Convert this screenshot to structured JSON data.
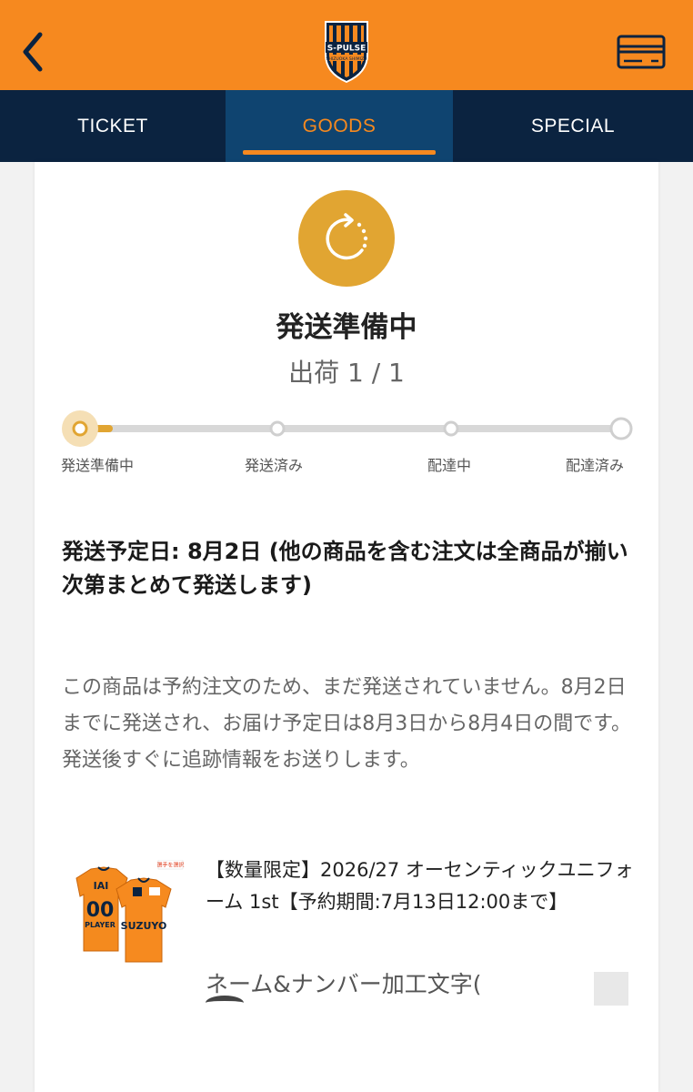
{
  "header": {
    "back_icon": "chevron-left-icon",
    "logo_text": "S-PULSE",
    "logo_subtext": "SHIZUOKA SHIMIZU",
    "card_icon": "credit-card-icon",
    "colors": {
      "orange": "#f6891f",
      "navy": "#0b2340",
      "active_tab_bg": "#0f4470"
    }
  },
  "tabs": [
    {
      "label": "TICKET",
      "active": false
    },
    {
      "label": "GOODS",
      "active": true
    },
    {
      "label": "SPECIAL",
      "active": false
    }
  ],
  "status": {
    "icon": "loading-circle-icon",
    "title": "発送準備中",
    "shipment": "出荷 1 / 1",
    "accent_color": "#e1a532",
    "steps": [
      "発送準備中",
      "発送済み",
      "配達中",
      "配達済み"
    ],
    "current_step": 1
  },
  "ship_date_text": "発送予定日: 8月2日 (他の商品を含む注文は全商品が揃い次第まとめて発送します)",
  "notice_text": "この商品は予約注文のため、まだ発送されていません。8月2日までに発送され、お届け予定日は8月3日から8月4日の間です。発送後すぐに追跡情報をお送りします。",
  "product": {
    "name": "【数量限定】2026/27 オーセンティックユニフォーム 1st【予約期間:7月13日12:00まで】",
    "custom_label": "ネーム&ナンバー加工文字(",
    "image_texts": {
      "number": "00",
      "player": "PLAYER",
      "sponsor": "SUZUYO",
      "badge": "選手を選択",
      "sleeve": "IAI"
    }
  }
}
